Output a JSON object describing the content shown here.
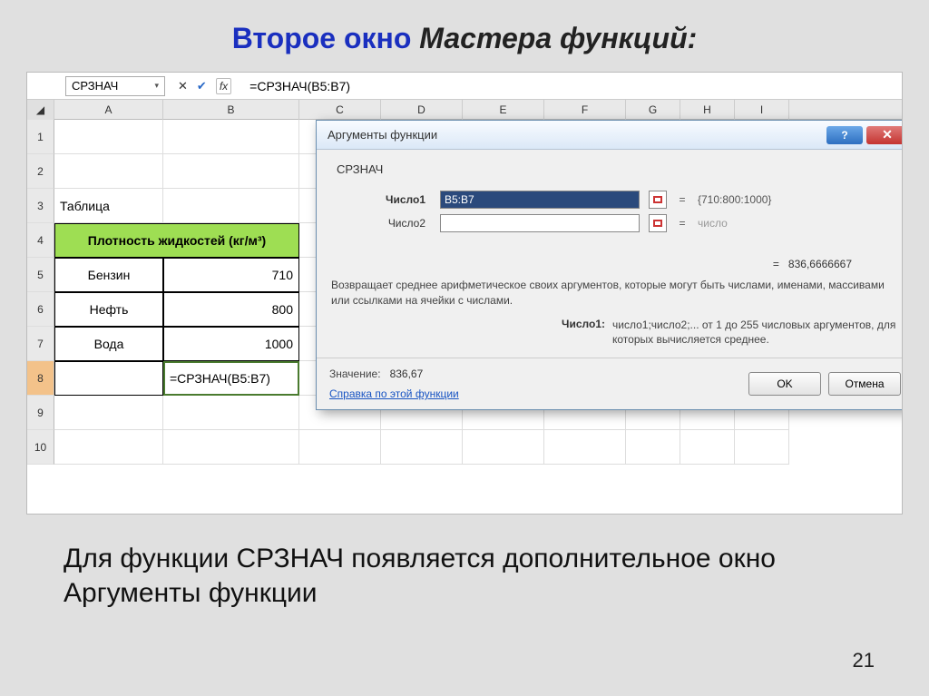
{
  "slide": {
    "title_part1": "Второе окно ",
    "title_part2": "Мастера функций:",
    "caption": "Для функции СРЗНАЧ появляется дополнительное окно Аргументы функции",
    "page_number": "21"
  },
  "excel": {
    "name_box_value": "СРЗНАЧ",
    "formula": "=СРЗНАЧ(B5:B7)",
    "columns": [
      "A",
      "B",
      "C",
      "D",
      "E",
      "F",
      "G",
      "H",
      "I"
    ],
    "rows": [
      "1",
      "2",
      "3",
      "4",
      "5",
      "6",
      "7",
      "8",
      "9",
      "10"
    ],
    "table_label": "Таблица",
    "table_header": "Плотность жидкостей (кг/м³)",
    "data": [
      {
        "name": "Бензин",
        "value": "710"
      },
      {
        "name": "Нефть",
        "value": "800"
      },
      {
        "name": "Вода",
        "value": "1000"
      }
    ],
    "active_formula_cell": "=СРЗНАЧ(B5:B7)"
  },
  "dialog": {
    "title": "Аргументы функции",
    "fn_name": "СРЗНАЧ",
    "args": [
      {
        "label": "Число1",
        "value": "B5:B7",
        "preview": "{710:800:1000}"
      },
      {
        "label": "Число2",
        "value": "",
        "preview": "число"
      }
    ],
    "result_preview_label": "=",
    "result_preview": "836,6666667",
    "description": "Возвращает среднее арифметическое своих аргументов, которые могут быть числами, именами, массивами или ссылками на ячейки с числами.",
    "arg_detail_key": "Число1:",
    "arg_detail_val": "число1;число2;... от 1 до 255 числовых аргументов, для которых вычисляется среднее.",
    "value_label": "Значение:",
    "value": "836,67",
    "help_link": "Справка по этой функции",
    "ok": "OK",
    "cancel": "Отмена"
  }
}
